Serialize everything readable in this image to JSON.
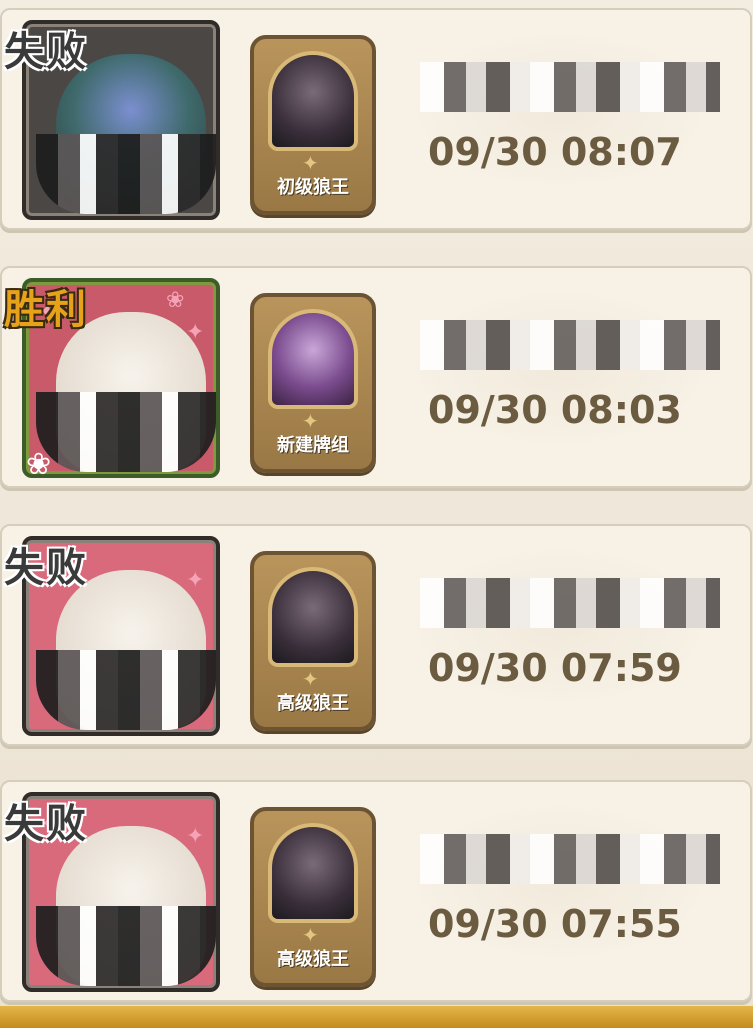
{
  "matches": [
    {
      "result": "失败",
      "deck_name": "初级狼王",
      "player_name": "",
      "timestamp": "09/30 08:07"
    },
    {
      "result": "胜利",
      "deck_name": "新建牌组",
      "player_name": "",
      "timestamp": "09/30 08:03"
    },
    {
      "result": "失败",
      "deck_name": "高级狼王",
      "player_name": "",
      "timestamp": "09/30 07:59"
    },
    {
      "result": "失败",
      "deck_name": "高级狼王",
      "player_name": "",
      "timestamp": "09/30 07:55"
    }
  ],
  "colors": {
    "loss_label": "#3a3a3a",
    "win_label": "#e7a21b",
    "timestamp": "#6b5b40",
    "panel_bg": "#f7f1e6"
  },
  "icons": {
    "deck_star": "star-icon",
    "sparkle": "sparkle-icon"
  }
}
